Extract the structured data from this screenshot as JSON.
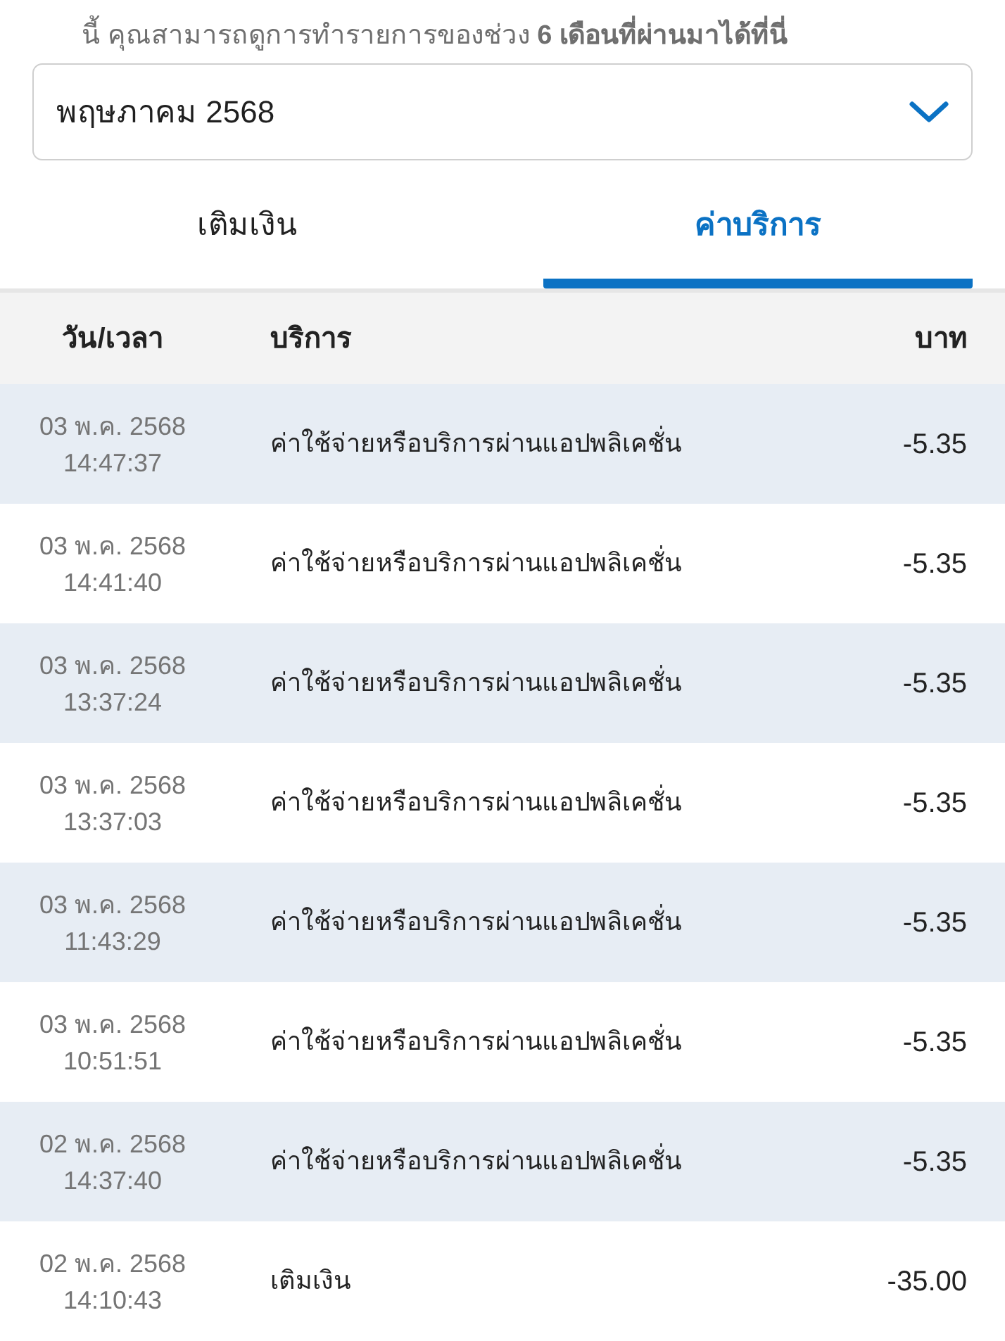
{
  "notice": {
    "text": "นี้ คุณสามารถดูการทำรายการของช่วง **6 เดือนที่ผ่านมาได้ที่นี่**"
  },
  "month_select": {
    "value": "พฤษภาคม 2568"
  },
  "tabs": [
    {
      "label": "เติมเงิน",
      "selected": false
    },
    {
      "label": "ค่าบริการ",
      "selected": true
    }
  ],
  "table": {
    "columns": [
      "วัน/เวลา",
      "บริการ",
      "บาท"
    ],
    "rows": [
      {
        "date": "03 พ.ค. 2568",
        "time": "14:47:37",
        "service": "ค่าใช้จ่ายหรือบริการผ่านแอปพลิเคชั่น",
        "amount": "-5.35"
      },
      {
        "date": "03 พ.ค. 2568",
        "time": "14:41:40",
        "service": "ค่าใช้จ่ายหรือบริการผ่านแอปพลิเคชั่น",
        "amount": "-5.35"
      },
      {
        "date": "03 พ.ค. 2568",
        "time": "13:37:24",
        "service": "ค่าใช้จ่ายหรือบริการผ่านแอปพลิเคชั่น",
        "amount": "-5.35"
      },
      {
        "date": "03 พ.ค. 2568",
        "time": "13:37:03",
        "service": "ค่าใช้จ่ายหรือบริการผ่านแอปพลิเคชั่น",
        "amount": "-5.35"
      },
      {
        "date": "03 พ.ค. 2568",
        "time": "11:43:29",
        "service": "ค่าใช้จ่ายหรือบริการผ่านแอปพลิเคชั่น",
        "amount": "-5.35"
      },
      {
        "date": "03 พ.ค. 2568",
        "time": "10:51:51",
        "service": "ค่าใช้จ่ายหรือบริการผ่านแอปพลิเคชั่น",
        "amount": "-5.35"
      },
      {
        "date": "02 พ.ค. 2568",
        "time": "14:37:40",
        "service": "ค่าใช้จ่ายหรือบริการผ่านแอปพลิเคชั่น",
        "amount": "-5.35"
      },
      {
        "date": "02 พ.ค. 2568",
        "time": "14:10:43",
        "service": "เติมเงิน",
        "amount": "-35.00"
      }
    ]
  }
}
